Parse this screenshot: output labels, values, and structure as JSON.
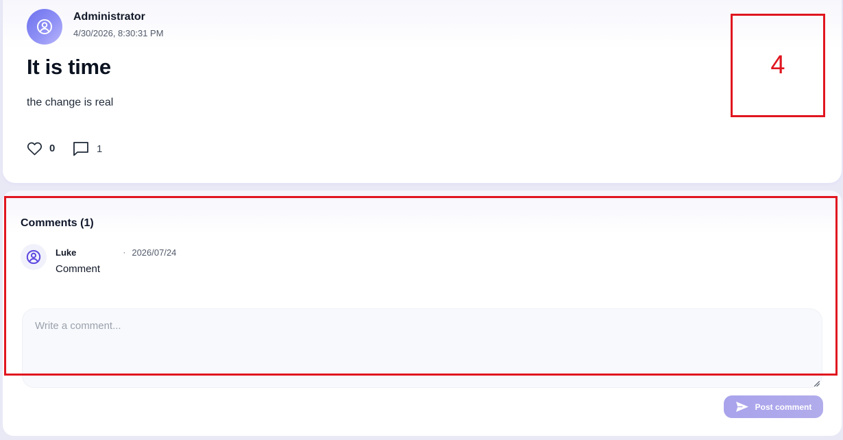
{
  "post": {
    "author": "Administrator",
    "timestamp": "4/30/2026, 8:30:31 PM",
    "title": "It is time",
    "body": "the change is real",
    "likes": "0",
    "comments": "1",
    "avatar_icon": "user-circle-icon",
    "like_icon": "heart-icon",
    "comment_icon": "speech-bubble-icon"
  },
  "annotation": {
    "number": "4",
    "color": "#e0151f"
  },
  "comments_section": {
    "heading": "Comments (1)",
    "items": [
      {
        "name": "Luke",
        "separator": "·",
        "date": "2026/07/24",
        "text": "Comment",
        "avatar_icon": "user-circle-icon"
      }
    ],
    "input": {
      "placeholder": "Write a comment...",
      "value": ""
    },
    "post_button": {
      "label": "Post comment",
      "icon": "send-icon"
    }
  },
  "colors": {
    "accent": "#6d72ee",
    "button": "#a9a3ec",
    "background": "#e9e9f6"
  }
}
